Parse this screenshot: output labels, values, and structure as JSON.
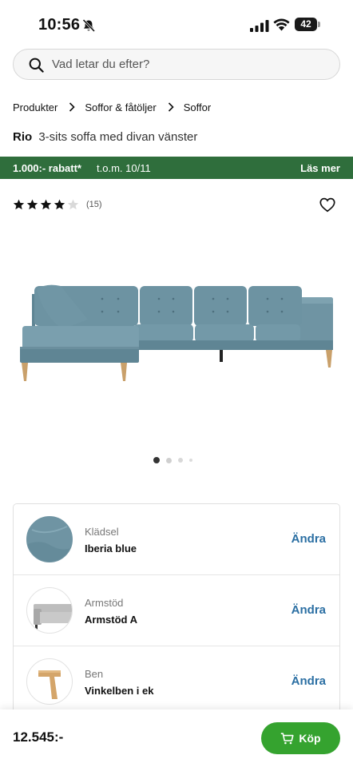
{
  "status_bar": {
    "time": "10:56",
    "battery": "42"
  },
  "search": {
    "placeholder": "Vad letar du efter?"
  },
  "breadcrumb": [
    "Produkter",
    "Soffor & fåtöljer",
    "Soffor"
  ],
  "product": {
    "brand": "Rio",
    "description": "3-sits soffa med divan vänster",
    "rating": 4,
    "rating_max": 5,
    "review_count": "(15)",
    "image_count": 4,
    "active_image": 1
  },
  "promo": {
    "label": "1.000:- rabatt*",
    "date": "t.o.m. 10/11",
    "link": "Läs mer",
    "color": "#2f6e3c"
  },
  "config": [
    {
      "label": "Klädsel",
      "value": "Iberia blue",
      "action": "Ändra",
      "thumb_icon": "fabric-swatch-icon"
    },
    {
      "label": "Armstöd",
      "value": "Armstöd A",
      "action": "Ändra",
      "thumb_icon": "armrest-icon"
    },
    {
      "label": "Ben",
      "value": "Vinkelben i ek",
      "action": "Ändra",
      "thumb_icon": "oak-leg-icon"
    }
  ],
  "footer": {
    "price": "12.545:-",
    "buy_label": "Köp",
    "buy_color": "#35a32f"
  },
  "colors": {
    "sofa": "#6f94a3",
    "action_link": "#2b6fa3"
  }
}
